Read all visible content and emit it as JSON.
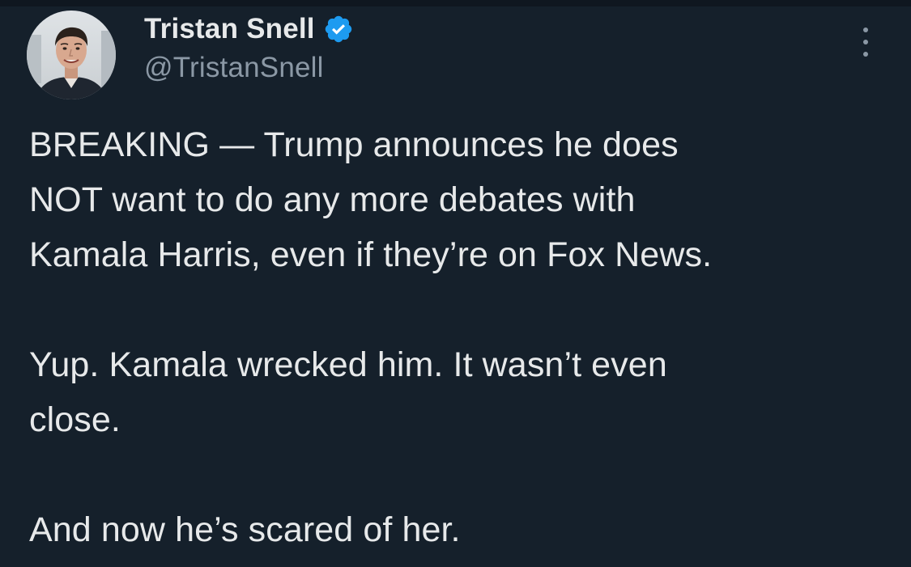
{
  "author": {
    "name": "Tristan Snell",
    "handle": "@TristanSnell",
    "verified": true,
    "verified_color": "#1d9bf0",
    "avatar_icon": "profile-photo-avatar"
  },
  "tweet": {
    "paragraphs": [
      "BREAKING — Trump announces he does\nNOT want to do any more debates with\nKamala Harris, even if they’re on Fox News.",
      "Yup. Kamala wrecked him. It wasn’t even\nclose.",
      "And now he’s scared of her."
    ]
  },
  "menu": {
    "icon": "more-vertical-icon"
  },
  "colors": {
    "background": "#15202b",
    "text": "#e7e9ea",
    "secondary_text": "#8b98a5"
  }
}
